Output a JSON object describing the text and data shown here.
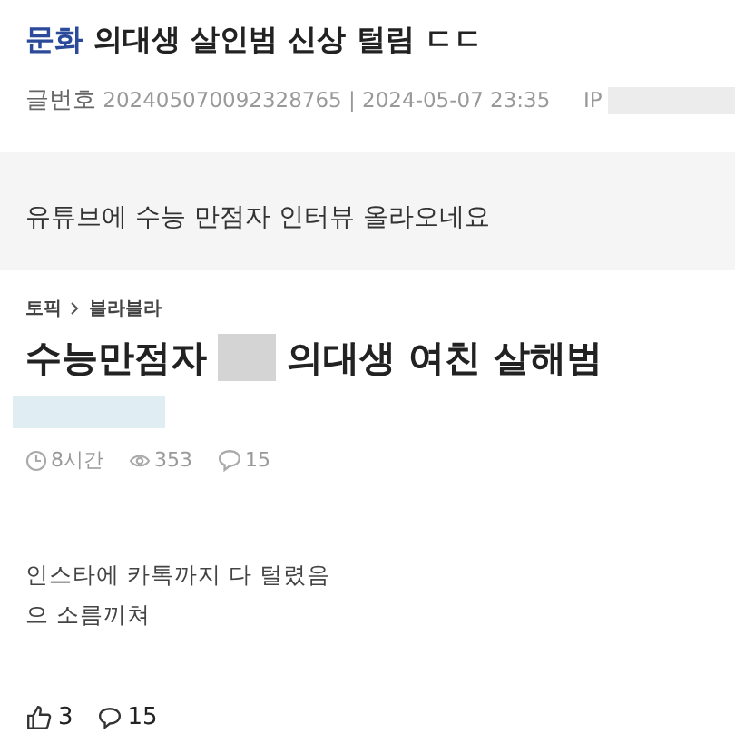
{
  "post": {
    "category": "문화",
    "title": "의대생 살인범 신상 털림 ㄷㄷ",
    "number_label": "글번호",
    "number": "202405070092328765",
    "separator": "|",
    "date": "2024-05-07 23:35",
    "ip_label": "IP"
  },
  "body": "유튜브에 수능 만점자 인터뷰 올라오네요",
  "embed": {
    "breadcrumb": [
      "토픽",
      "블라블라"
    ],
    "title_parts": [
      "수능만점자",
      "의대생 여친 살해범"
    ],
    "time": "8시간",
    "views": "353",
    "comments": "15",
    "lines": [
      "인스타에 카톡까지 다 털렸음",
      "으 소름끼쳐"
    ]
  },
  "footer": {
    "likes": "3",
    "comments": "15"
  }
}
